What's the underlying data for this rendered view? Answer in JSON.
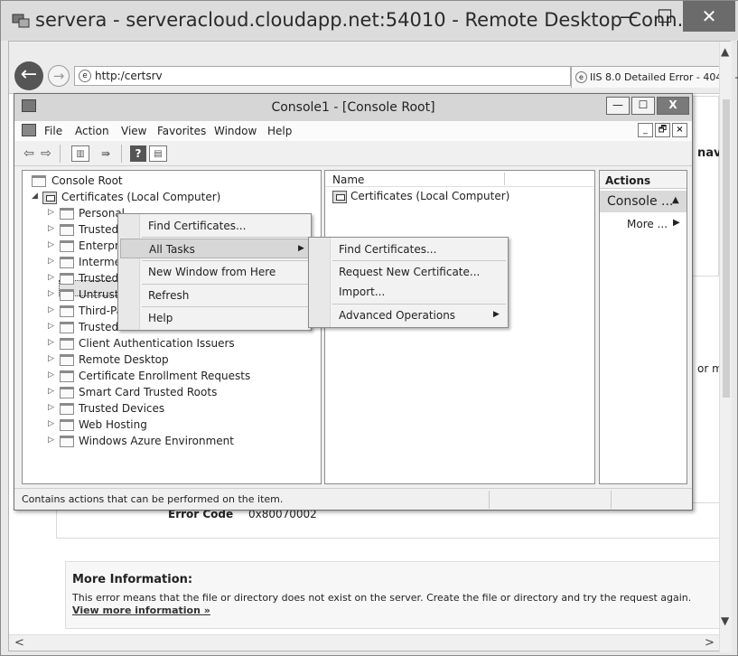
{
  "rdp_window": {
    "title": "servera - serveracloud.cloudapp.net:54010 - Remote Desktop Conn...",
    "min_label": "—",
    "max_label": "☐",
    "close_label": "✕"
  },
  "browser": {
    "back_glyph": "←",
    "forward_glyph": "→",
    "url": "http:/certsrv",
    "address_tools": "⚲ ▾ ⊠ →",
    "tab_title": "IIS 8.0 Detailed Error - 404.0 -",
    "scroll_up": "▲",
    "scroll_down": "▼",
    "scroll_left": "<",
    "scroll_right": ">"
  },
  "iis_page": {
    "nav_fragment": "nav",
    "orm_fragment": "or m",
    "error_code_label": "Error Code",
    "error_code_value": "0x80070002",
    "more_info_title": "More Information:",
    "more_info_text": "This error means that the file or directory does not exist on the server. Create the file or directory and try the request again.",
    "more_info_link": "View more information »"
  },
  "mmc": {
    "title": "Console1 - [Console Root]",
    "min_label": "—",
    "max_label": "☐",
    "close_label": "X",
    "menu": {
      "file": "File",
      "action": "Action",
      "view": "View",
      "favorites": "Favorites",
      "window": "Window",
      "help": "Help"
    },
    "mdi": {
      "min": "_",
      "restore": "🗗",
      "close": "×"
    },
    "toolbar": {
      "back": "⇦",
      "forward": "⇨",
      "tree": "▥",
      "export": "⇛",
      "help": "?",
      "action": "▤"
    },
    "tree": {
      "root": "Console Root",
      "certificates": "Certificates (Local Computer)",
      "stores": [
        "Personal",
        "Trusted",
        "Enterpris",
        "Intermec",
        "Trusted",
        "Untruste",
        "Third-Pa",
        "Trusted",
        "Client Authentication Issuers",
        "Remote Desktop",
        "Certificate Enrollment Requests",
        "Smart Card Trusted Roots",
        "Trusted Devices",
        "Web Hosting",
        "Windows Azure Environment"
      ]
    },
    "results": {
      "column_name": "Name",
      "row": "Certificates (Local Computer)"
    },
    "actions": {
      "header": "Actions",
      "console": "Console ...",
      "more": "More ..."
    },
    "status": "Contains actions that can be performed on the item."
  },
  "context_menu": {
    "find": "Find Certificates...",
    "all_tasks": "All Tasks",
    "new_window": "New Window from Here",
    "refresh": "Refresh",
    "help": "Help"
  },
  "submenu": {
    "find": "Find Certificates...",
    "request": "Request New Certificate...",
    "import": "Import...",
    "advanced": "Advanced Operations"
  }
}
